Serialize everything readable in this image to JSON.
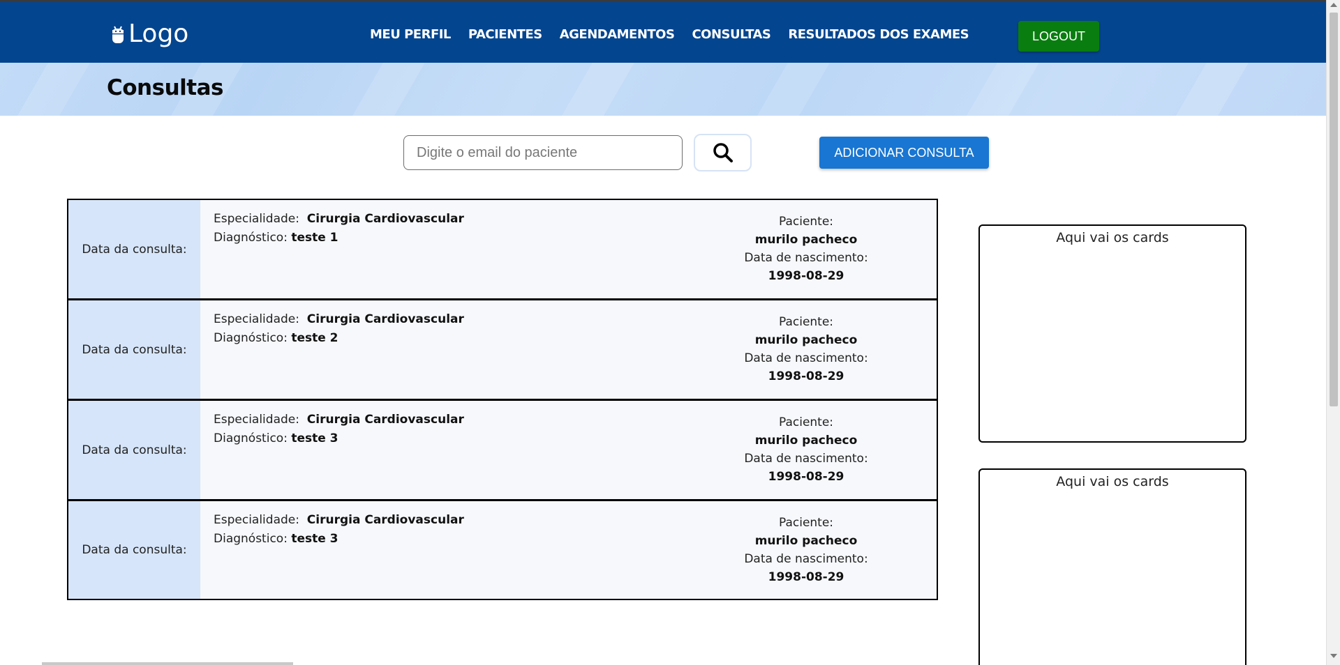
{
  "header": {
    "logo_text": "Logo",
    "nav": [
      "MEU PERFIL",
      "PACIENTES",
      "AGENDAMENTOS",
      "CONSULTAS",
      "RESULTADOS DOS EXAMES"
    ],
    "logout_label": "LOGOUT",
    "bg_color": "#04458f",
    "logout_color": "#0a7d10"
  },
  "banner": {
    "title": "Consultas"
  },
  "search": {
    "placeholder": "Digite o email do paciente",
    "search_icon": "search-icon",
    "add_label": "ADICIONAR CONSULTA",
    "add_color": "#1976d2"
  },
  "consultas": [
    {
      "date_label": "Data da consulta:",
      "especialidade_label": "Especialidade:",
      "especialidade": "Cirurgia Cardiovascular",
      "diagnostico_label": "Diagnóstico:",
      "diagnostico": "teste 1",
      "paciente_label": "Paciente:",
      "paciente": "murilo pacheco",
      "nascimento_label": "Data de nascimento:",
      "nascimento": "1998-08-29"
    },
    {
      "date_label": "Data da consulta:",
      "especialidade_label": "Especialidade:",
      "especialidade": "Cirurgia Cardiovascular",
      "diagnostico_label": "Diagnóstico:",
      "diagnostico": "teste 2",
      "paciente_label": "Paciente:",
      "paciente": "murilo pacheco",
      "nascimento_label": "Data de nascimento:",
      "nascimento": "1998-08-29"
    },
    {
      "date_label": "Data da consulta:",
      "especialidade_label": "Especialidade:",
      "especialidade": "Cirurgia Cardiovascular",
      "diagnostico_label": "Diagnóstico:",
      "diagnostico": "teste 3",
      "paciente_label": "Paciente:",
      "paciente": "murilo pacheco",
      "nascimento_label": "Data de nascimento:",
      "nascimento": "1998-08-29"
    },
    {
      "date_label": "Data da consulta:",
      "especialidade_label": "Especialidade:",
      "especialidade": "Cirurgia Cardiovascular",
      "diagnostico_label": "Diagnóstico:",
      "diagnostico": "teste 3",
      "paciente_label": "Paciente:",
      "paciente": "murilo pacheco",
      "nascimento_label": "Data de nascimento:",
      "nascimento": "1998-08-29"
    }
  ],
  "side_cards": [
    {
      "title": "Aqui vai os cards"
    },
    {
      "title": "Aqui vai os cards"
    }
  ]
}
